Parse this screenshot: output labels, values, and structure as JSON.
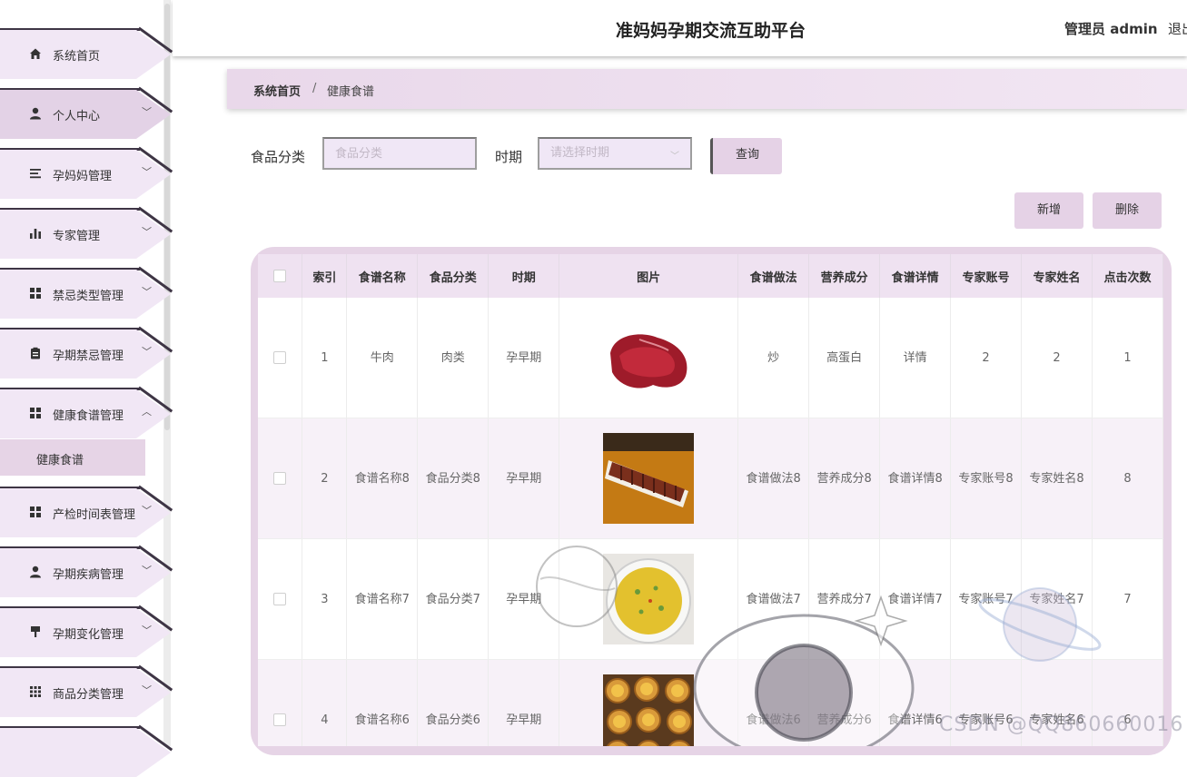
{
  "header": {
    "title": "准妈妈孕期交流互助平台",
    "user": "管理员 admin",
    "logout": "退出"
  },
  "sidebar": {
    "items": [
      {
        "label": "系统首页",
        "icon": "home-icon",
        "glyph": "⌂"
      },
      {
        "label": "个人中心",
        "icon": "user-icon",
        "glyph": "●"
      },
      {
        "label": "孕妈妈管理",
        "icon": "list-icon",
        "glyph": "☰"
      },
      {
        "label": "专家管理",
        "icon": "bar-chart-icon",
        "glyph": "▮"
      },
      {
        "label": "禁忌类型管理",
        "icon": "grid-icon",
        "glyph": "▦"
      },
      {
        "label": "孕期禁忌管理",
        "icon": "clipboard-icon",
        "glyph": "▤"
      },
      {
        "label": "健康食谱管理",
        "icon": "grid-icon",
        "glyph": "▦"
      },
      {
        "label": "产检时间表管理",
        "icon": "grid-icon",
        "glyph": "▦"
      },
      {
        "label": "孕期疾病管理",
        "icon": "user-icon",
        "glyph": "●"
      },
      {
        "label": "孕期变化管理",
        "icon": "brush-icon",
        "glyph": "▼"
      },
      {
        "label": "商品分类管理",
        "icon": "apps-icon",
        "glyph": "▦"
      }
    ],
    "submenu_active": "健康食谱"
  },
  "breadcrumb": {
    "home": "系统首页",
    "separator": "/",
    "current": "健康食谱"
  },
  "search": {
    "category_label": "食品分类",
    "category_placeholder": "食品分类",
    "period_label": "时期",
    "period_placeholder": "请选择时期",
    "query_label": "查询"
  },
  "actions": {
    "add_label": "新增",
    "delete_label": "删除"
  },
  "table": {
    "columns": [
      "索引",
      "食谱名称",
      "食品分类",
      "时期",
      "图片",
      "食谱做法",
      "营养成分",
      "食谱详情",
      "专家账号",
      "专家姓名",
      "点击次数"
    ],
    "rows": [
      {
        "index": "1",
        "name": "牛肉",
        "category": "肉类",
        "period": "孕早期",
        "image": "beef",
        "method": "炒",
        "nutrition": "高蛋白",
        "detail": "详情",
        "account": "2",
        "expert": "2",
        "clicks": "1"
      },
      {
        "index": "2",
        "name": "食谱名称8",
        "category": "食品分类8",
        "period": "孕早期",
        "image": "sausage",
        "method": "食谱做法8",
        "nutrition": "营养成分8",
        "detail": "食谱详情8",
        "account": "专家账号8",
        "expert": "专家姓名8",
        "clicks": "8"
      },
      {
        "index": "3",
        "name": "食谱名称7",
        "category": "食品分类7",
        "period": "孕早期",
        "image": "omelette",
        "method": "食谱做法7",
        "nutrition": "营养成分7",
        "detail": "食谱详情7",
        "account": "专家账号7",
        "expert": "专家姓名7",
        "clicks": "7"
      },
      {
        "index": "4",
        "name": "食谱名称6",
        "category": "食品分类6",
        "period": "孕早期",
        "image": "egg-tart",
        "method": "食谱做法6",
        "nutrition": "营养成分6",
        "detail": "食谱详情6",
        "account": "专家账号6",
        "expert": "专家姓名6",
        "clicks": "6"
      }
    ]
  },
  "watermark": "CSDN @QQ860660016",
  "colors": {
    "accent": "#e5d2e6",
    "menu_bg": "#f1e7f5",
    "header_row": "#efe2f1",
    "border_dark": "#3e3545"
  }
}
